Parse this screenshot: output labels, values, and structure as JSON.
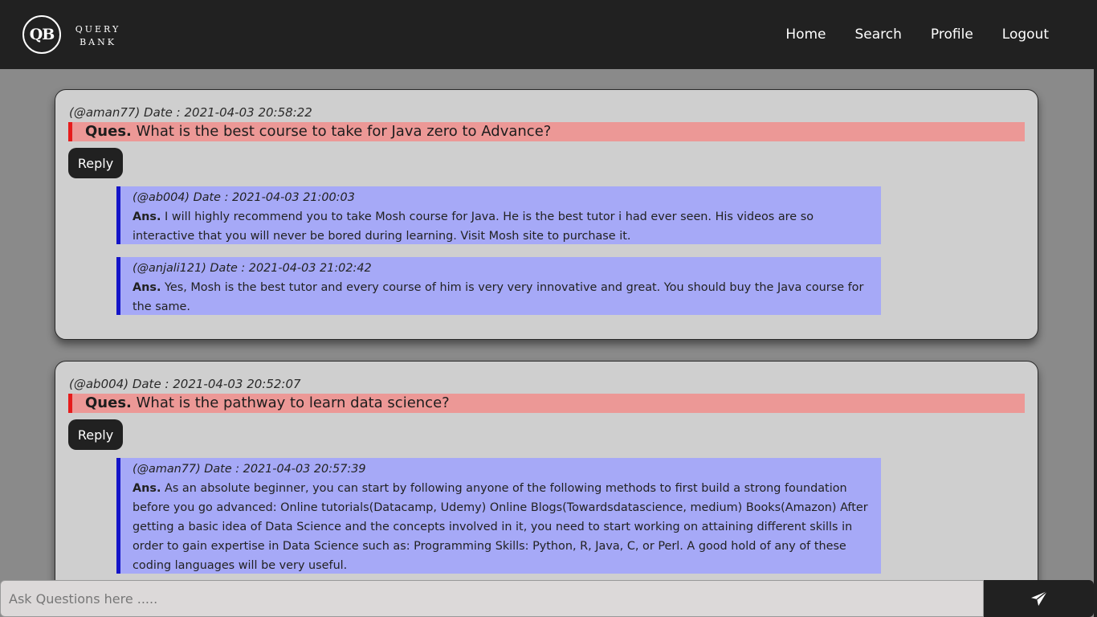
{
  "brand": {
    "logo_initials": "QB",
    "name_line1": "QUERY",
    "name_line2": "BANK"
  },
  "nav": [
    {
      "label": "Home"
    },
    {
      "label": "Search"
    },
    {
      "label": "Profile"
    },
    {
      "label": "Logout"
    }
  ],
  "questions": [
    {
      "meta": "(@aman77) Date : 2021-04-03 20:58:22",
      "prefix": "Ques.",
      "text": "What is the best course to take for Java zero to Advance?",
      "reply_label": "Reply",
      "answers": [
        {
          "meta": "(@ab004) Date : 2021-04-03 21:00:03",
          "prefix": "Ans.",
          "text": "I will highly recommend you to take Mosh course for Java. He is the best tutor i had ever seen. His videos are so interactive that you will never be bored during learning. Visit Mosh site to purchase it."
        },
        {
          "meta": "(@anjali121) Date : 2021-04-03 21:02:42",
          "prefix": "Ans.",
          "text": "Yes, Mosh is the best tutor and every course of him is very very innovative and great. You should buy the Java course for the same."
        }
      ]
    },
    {
      "meta": "(@ab004) Date : 2021-04-03 20:52:07",
      "prefix": "Ques.",
      "text": "What is the pathway to learn data science?",
      "reply_label": "Reply",
      "answers": [
        {
          "meta": "(@aman77) Date : 2021-04-03 20:57:39",
          "prefix": "Ans.",
          "text": "As an absolute beginner, you can start by following anyone of the following methods to first build a strong foundation before you go advanced: Online tutorials(Datacamp, Udemy) Online Blogs(Towardsdatascience, medium) Books(Amazon) After getting a basic idea of Data Science and the concepts involved in it, you need to start working on attaining different skills in order to gain expertise in Data Science such as: Programming Skills: Python, R, Java, C, or Perl. A good hold of any of these coding languages will be very useful."
        }
      ]
    }
  ],
  "ask": {
    "placeholder": "Ask Questions here .....",
    "send_icon": "paper-plane-icon"
  },
  "colors": {
    "navbar": "#212121",
    "question_bar": "#ec9896",
    "question_accent": "#e51c1c",
    "answer_bg": "#a6a9f7",
    "answer_accent": "#1414c8"
  }
}
